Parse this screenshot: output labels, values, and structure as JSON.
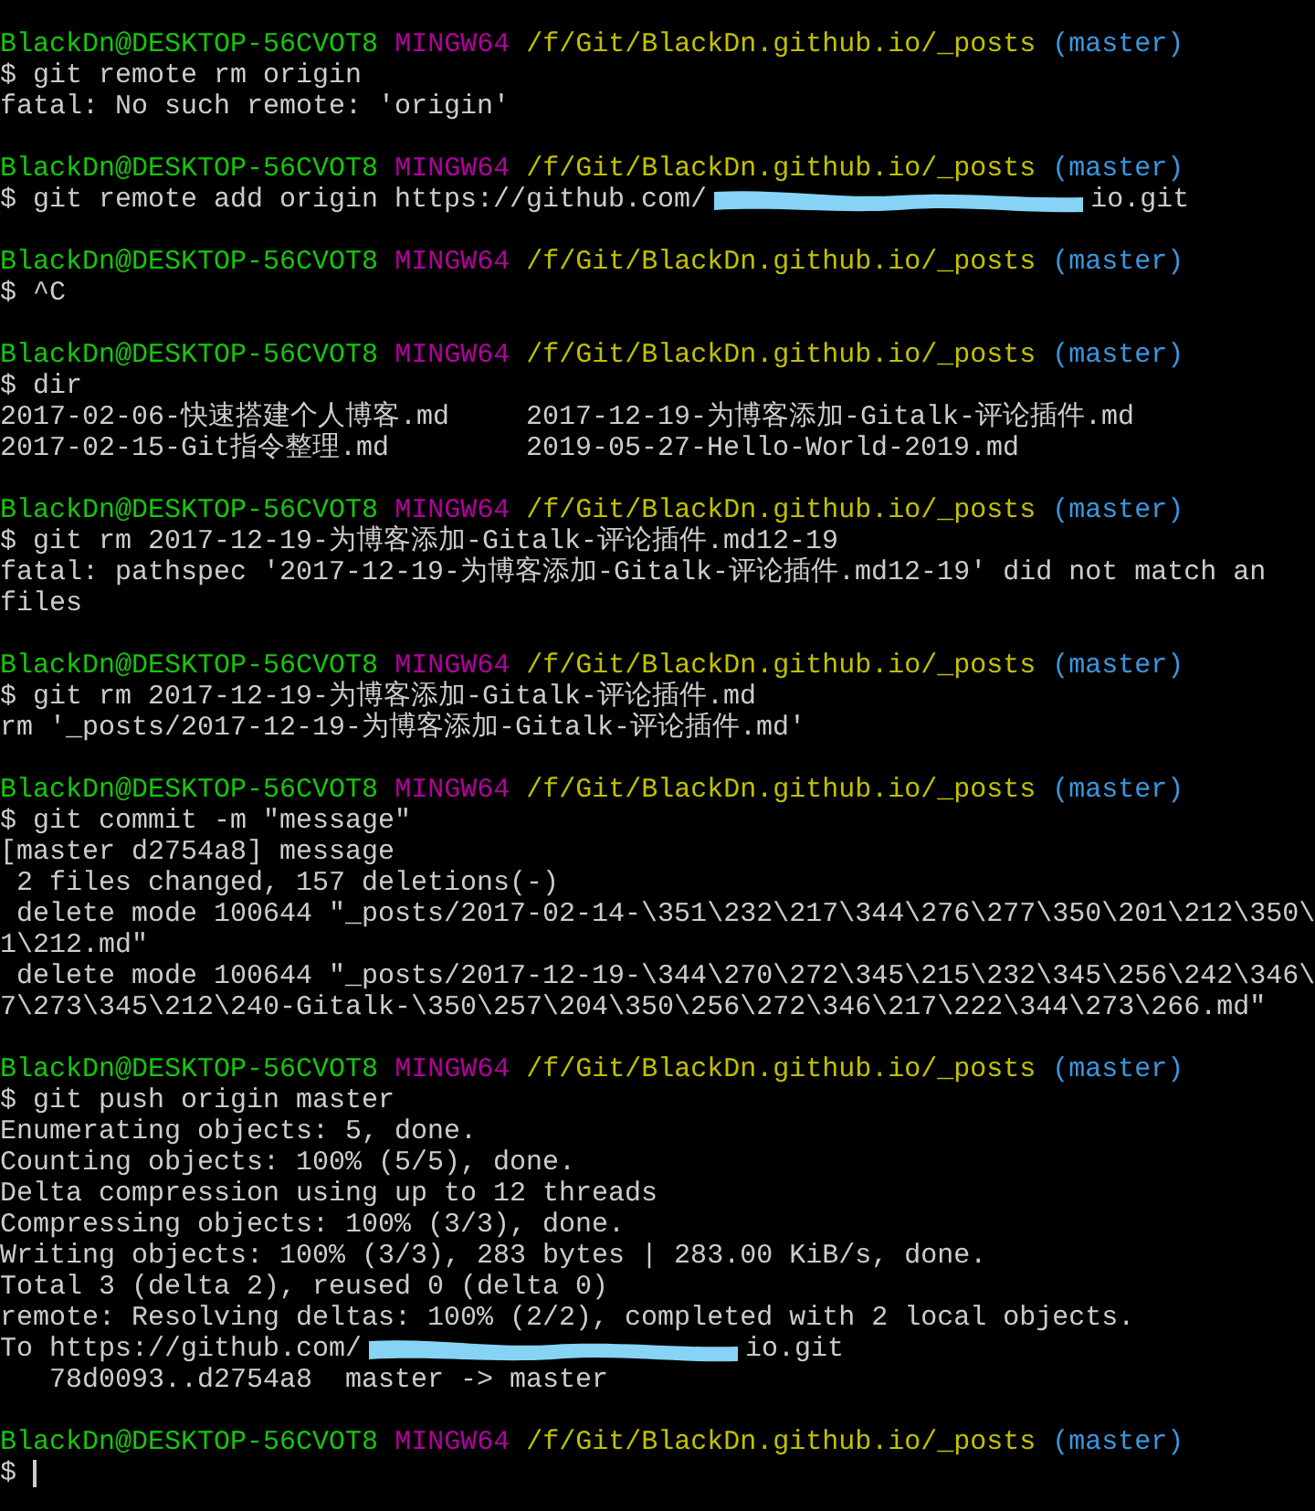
{
  "terminal": {
    "blocks": [
      {
        "prompt": {
          "user_host": "BlackDn@DESKTOP-56CVOT8",
          "system": "MINGW64",
          "path": "/f/Git/BlackDn.github.io/_posts",
          "branch": "(master)"
        },
        "command": "$ git remote rm origin",
        "output": [
          {
            "kind": "text",
            "text": "fatal: No such remote: 'origin'"
          }
        ]
      },
      {
        "prompt": {
          "user_host": "BlackDn@DESKTOP-56CVOT8",
          "system": "MINGW64",
          "path": "/f/Git/BlackDn.github.io/_posts",
          "branch": "(master)"
        },
        "command": "$ git remote add origin https://github.com/",
        "command_after_redaction": "io.git"
      },
      {
        "prompt": {
          "user_host": "BlackDn@DESKTOP-56CVOT8",
          "system": "MINGW64",
          "path": "/f/Git/BlackDn.github.io/_posts",
          "branch": "(master)"
        },
        "command": "$ ^C"
      },
      {
        "prompt": {
          "user_host": "BlackDn@DESKTOP-56CVOT8",
          "system": "MINGW64",
          "path": "/f/Git/BlackDn.github.io/_posts",
          "branch": "(master)"
        },
        "command": "$ dir",
        "output": [
          {
            "kind": "columns",
            "cells": [
              "2017-02-06-快速搭建个人博客.md",
              "2017-12-19-为博客添加-Gitalk-评论插件.md"
            ]
          },
          {
            "kind": "columns",
            "cells": [
              "2017-02-15-Git指令整理.md",
              "2019-05-27-Hello-World-2019.md"
            ]
          }
        ]
      },
      {
        "prompt": {
          "user_host": "BlackDn@DESKTOP-56CVOT8",
          "system": "MINGW64",
          "path": "/f/Git/BlackDn.github.io/_posts",
          "branch": "(master)"
        },
        "command": "$ git rm 2017-12-19-为博客添加-Gitalk-评论插件.md12-19",
        "output": [
          {
            "kind": "text",
            "text": "fatal: pathspec '2017-12-19-为博客添加-Gitalk-评论插件.md12-19' did not match an"
          },
          {
            "kind": "text",
            "text": "files"
          }
        ]
      },
      {
        "prompt": {
          "user_host": "BlackDn@DESKTOP-56CVOT8",
          "system": "MINGW64",
          "path": "/f/Git/BlackDn.github.io/_posts",
          "branch": "(master)"
        },
        "command": "$ git rm 2017-12-19-为博客添加-Gitalk-评论插件.md",
        "output": [
          {
            "kind": "text",
            "text": "rm '_posts/2017-12-19-为博客添加-Gitalk-评论插件.md'"
          }
        ]
      },
      {
        "prompt": {
          "user_host": "BlackDn@DESKTOP-56CVOT8",
          "system": "MINGW64",
          "path": "/f/Git/BlackDn.github.io/_posts",
          "branch": "(master)"
        },
        "command": "$ git commit -m \"message\"",
        "output": [
          {
            "kind": "text",
            "text": "[master d2754a8] message"
          },
          {
            "kind": "text",
            "text": " 2 files changed, 157 deletions(-)"
          },
          {
            "kind": "text",
            "text": " delete mode 100644 \"_posts/2017-02-14-\\351\\232\\217\\344\\276\\277\\350\\201\\212\\350\\"
          },
          {
            "kind": "text",
            "text": "1\\212.md\""
          },
          {
            "kind": "text",
            "text": " delete mode 100644 \"_posts/2017-12-19-\\344\\270\\272\\345\\215\\232\\345\\256\\242\\346\\"
          },
          {
            "kind": "text",
            "text": "7\\273\\345\\212\\240-Gitalk-\\350\\257\\204\\350\\256\\272\\346\\217\\222\\344\\273\\266.md\""
          }
        ]
      },
      {
        "prompt": {
          "user_host": "BlackDn@DESKTOP-56CVOT8",
          "system": "MINGW64",
          "path": "/f/Git/BlackDn.github.io/_posts",
          "branch": "(master)"
        },
        "command": "$ git push origin master",
        "output": [
          {
            "kind": "text",
            "text": "Enumerating objects: 5, done."
          },
          {
            "kind": "text",
            "text": "Counting objects: 100% (5/5), done."
          },
          {
            "kind": "text",
            "text": "Delta compression using up to 12 threads"
          },
          {
            "kind": "text",
            "text": "Compressing objects: 100% (3/3), done."
          },
          {
            "kind": "text",
            "text": "Writing objects: 100% (3/3), 283 bytes | 283.00 KiB/s, done."
          },
          {
            "kind": "text",
            "text": "Total 3 (delta 2), reused 0 (delta 0)"
          },
          {
            "kind": "text",
            "text": "remote: Resolving deltas: 100% (2/2), completed with 2 local objects."
          },
          {
            "kind": "redacted",
            "before": "To https://github.com/",
            "after": "io.git"
          },
          {
            "kind": "text",
            "text": "   78d0093..d2754a8  master -> master"
          }
        ]
      },
      {
        "prompt": {
          "user_host": "BlackDn@DESKTOP-56CVOT8",
          "system": "MINGW64",
          "path": "/f/Git/BlackDn.github.io/_posts",
          "branch": "(master)"
        },
        "command": "$",
        "cursor": true
      }
    ]
  }
}
